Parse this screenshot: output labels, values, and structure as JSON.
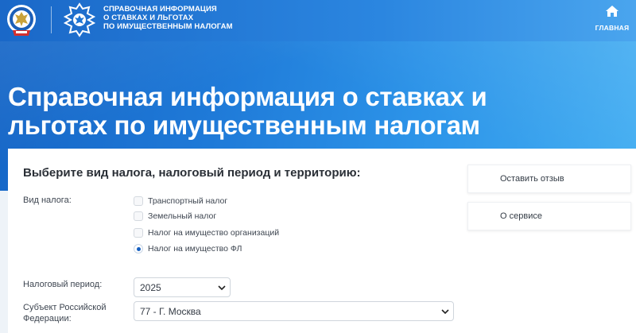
{
  "header": {
    "title_lines": [
      "СПРАВОЧНАЯ ИНФОРМАЦИЯ",
      "О СТАВКАХ И ЛЬГОТАХ",
      "ПО ИМУЩЕСТВЕННЫМ НАЛОГАМ"
    ],
    "home_label": "ГЛАВНАЯ",
    "home_icon": "home-icon",
    "logos": [
      "fns-emblem-logo",
      "eagle-emblem-logo"
    ]
  },
  "page": {
    "title": "Справочная информация о ставках и льготах по имущественным налогам"
  },
  "form": {
    "heading": "Выберите вид налога, налоговый период и территорию:",
    "tax_type_label": "Вид налога:",
    "tax_types": [
      {
        "label": "Транспортный налог",
        "selected": false
      },
      {
        "label": "Земельный налог",
        "selected": false
      },
      {
        "label": "Налог на имущество организаций",
        "selected": false
      },
      {
        "label": "Налог на имущество ФЛ",
        "selected": true
      }
    ],
    "period_label": "Налоговый период:",
    "period_value": "2025",
    "region_label_lines": [
      "Субъект Российской",
      "Федерации:"
    ],
    "region_value": "77 - Г. Москва"
  },
  "sidebar": {
    "feedback_label": "Оставить отзыв",
    "about_label": "О сервисе"
  },
  "colors": {
    "brand_blue": "#1e74d3",
    "accent_blue": "#1660c1",
    "text": "#2a2f36"
  }
}
